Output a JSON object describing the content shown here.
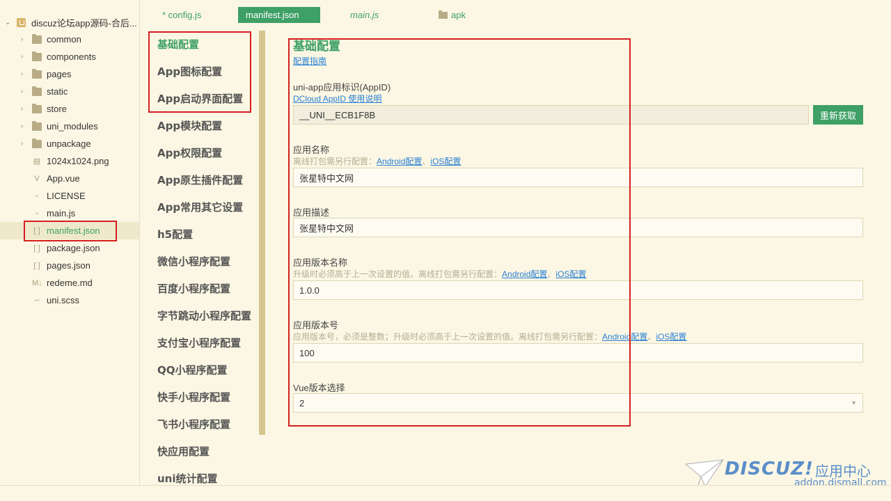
{
  "explorer": {
    "project_name": "discuz论坛app源码-合后...",
    "items": [
      {
        "label": "common",
        "type": "folder"
      },
      {
        "label": "components",
        "type": "folder"
      },
      {
        "label": "pages",
        "type": "folder"
      },
      {
        "label": "static",
        "type": "folder"
      },
      {
        "label": "store",
        "type": "folder"
      },
      {
        "label": "uni_modules",
        "type": "folder"
      },
      {
        "label": "unpackage",
        "type": "folder"
      },
      {
        "label": "1024x1024.png",
        "type": "image"
      },
      {
        "label": "App.vue",
        "type": "vue"
      },
      {
        "label": "LICENSE",
        "type": "file"
      },
      {
        "label": "main.js",
        "type": "file"
      },
      {
        "label": "manifest.json",
        "type": "json",
        "active": true
      },
      {
        "label": "package.json",
        "type": "json"
      },
      {
        "label": "pages.json",
        "type": "json"
      },
      {
        "label": "redeme.md",
        "type": "markdown"
      },
      {
        "label": "uni.scss",
        "type": "scss"
      }
    ]
  },
  "tabs": [
    {
      "label": "* config.js"
    },
    {
      "label": "manifest.json",
      "active": true
    },
    {
      "label": "main.js"
    },
    {
      "label": "apk"
    }
  ],
  "settings_nav": {
    "items": [
      "基础配置",
      "App图标配置",
      "App启动界面配置",
      "App模块配置",
      "App权限配置",
      "App原生插件配置",
      "App常用其它设置",
      "h5配置",
      "微信小程序配置",
      "百度小程序配置",
      "字节跳动小程序配置",
      "支付宝小程序配置",
      "QQ小程序配置",
      "快手小程序配置",
      "飞书小程序配置",
      "快应用配置",
      "uni统计配置"
    ]
  },
  "form": {
    "section_title": "基础配置",
    "guide_link": "配置指南",
    "appid": {
      "label": "uni-app应用标识(AppID)",
      "help_link": "DCloud AppID 使用说明",
      "value": "__UNI__ECB1F8B",
      "refresh_button": "重新获取"
    },
    "app_name": {
      "label": "应用名称",
      "hint": "离线打包需另行配置：",
      "android_link": "Android配置",
      "separator": "、",
      "ios_link": "iOS配置",
      "value": "张星特中文网"
    },
    "app_desc": {
      "label": "应用描述",
      "value": "张星特中文网"
    },
    "version_name": {
      "label": "应用版本名称",
      "hint": "升级时必须高于上一次设置的值。离线打包需另行配置：",
      "android_link": "Android配置",
      "separator": "、",
      "ios_link": "iOS配置",
      "value": "1.0.0"
    },
    "version_code": {
      "label": "应用版本号",
      "hint": "应用版本号，必须是整数；升级时必须高于上一次设置的值。离线打包需另行配置：",
      "android_link": "Android配置",
      "separator": "、",
      "ios_link": "iOS配置",
      "value": "100"
    },
    "vue_version": {
      "label": "Vue版本选择",
      "value": "2"
    }
  },
  "watermark": {
    "brand": "DISCUZ!",
    "cn": "应用中心",
    "url": "addon.dismall.com"
  },
  "colors": {
    "accent": "#3ea065",
    "highlight_box": "#d41f1f",
    "link": "#2a7fd4",
    "background": "#fbf7e4"
  }
}
